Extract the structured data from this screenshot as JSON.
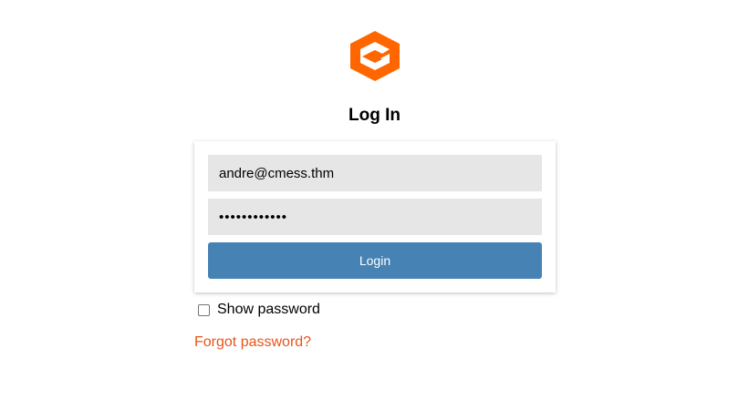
{
  "brand": {
    "logo_icon": "hexagon-g-logo-icon",
    "logo_color": "#ff6600"
  },
  "login": {
    "title": "Log In",
    "email_value": "andre@cmess.thm",
    "password_value": "••••••••••••",
    "login_button_label": "Login",
    "button_color": "#4682b4"
  },
  "options": {
    "show_password_label": "Show password",
    "show_password_checked": false,
    "forgot_password_label": "Forgot password?",
    "link_color": "#e8541c"
  }
}
